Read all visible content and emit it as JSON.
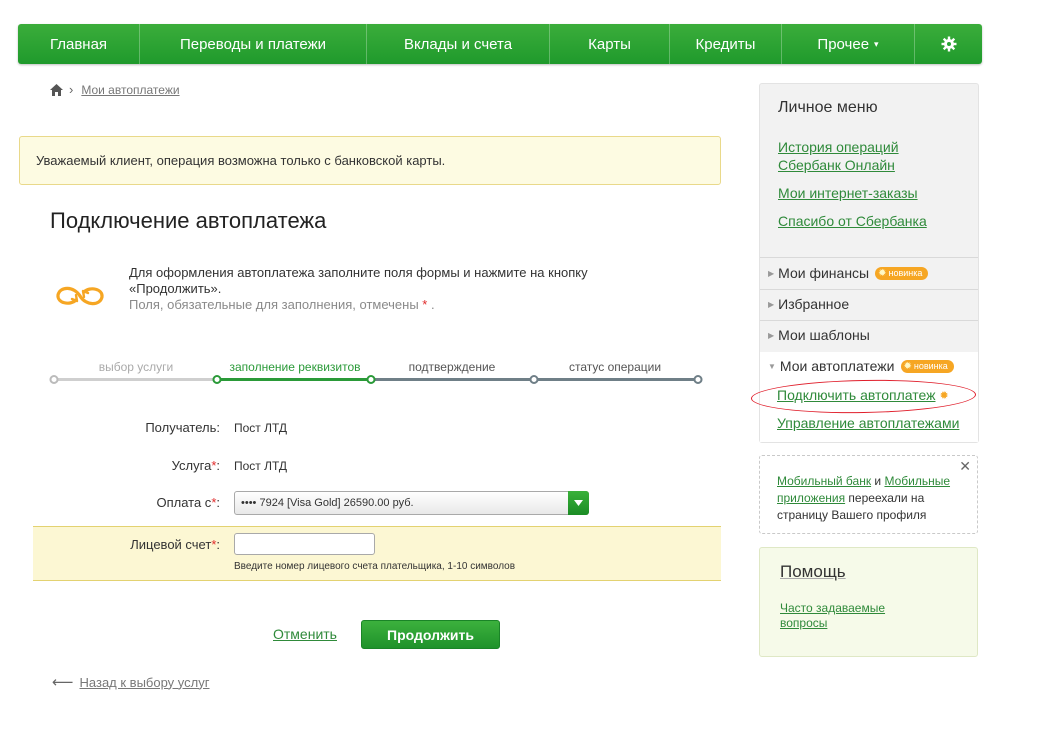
{
  "nav": {
    "items": [
      "Главная",
      "Переводы и платежи",
      "Вклады и счета",
      "Карты",
      "Кредиты",
      "Прочее"
    ],
    "settings_icon": "gear-icon"
  },
  "breadcrumb": {
    "home_icon": "home-icon",
    "link": "Мои автоплатежи"
  },
  "alert": {
    "text": "Уважаемый клиент, операция возможна только с банковской карты."
  },
  "page": {
    "title": "Подключение автоплатежа",
    "intro_icon": "infinity-icon",
    "intro_text": "Для оформления автоплатежа заполните поля формы и нажмите на кнопку «Продолжить».",
    "required_note_prefix": "Поля, обязательные для заполнения, отмечены",
    "required_star": "*",
    "required_note_suffix": "."
  },
  "steps": {
    "labels": [
      "выбор услуги",
      "заполнение реквизитов",
      "подтверждение",
      "статус операции"
    ],
    "active_index": 1
  },
  "form": {
    "recipient_label": "Получатель:",
    "recipient_value": "Пост ЛТД",
    "service_label": "Услуга",
    "service_value": "Пост ЛТД",
    "payment_label": "Оплата с",
    "payment_value": "•••• 7924 [Visa Gold] 26590.00 руб.",
    "account_label": "Лицевой счет",
    "account_value": "",
    "account_hint": "Введите номер лицевого счета плательщика, 1-10 символов",
    "star": "*",
    "colon": ":"
  },
  "actions": {
    "cancel": "Отменить",
    "continue": "Продолжить",
    "back": "Назад к выбору услуг"
  },
  "sidebar": {
    "title": "Личное меню",
    "links": [
      "История операций Сбербанк Онлайн",
      "Мои интернет-заказы",
      "Спасибо от Сбербанка"
    ],
    "sections": [
      "Мои финансы",
      "Избранное",
      "Мои шаблоны",
      "Мои автоплатежи"
    ],
    "badge": "новинка",
    "sub_links": [
      "Подключить автоплатеж",
      "Управление автоплатежами"
    ]
  },
  "notice": {
    "link1": "Мобильный банк",
    "and": " и ",
    "link2": "Мобильные приложения",
    "text": " переехали на страницу Вашего профиля"
  },
  "help": {
    "title": "Помощь",
    "link": "Часто задаваемые вопросы"
  },
  "colors": {
    "brand_green": "#21a038",
    "link_green": "#2f8a3a",
    "badge_orange": "#f6a623",
    "highlight_red": "#e01e2b"
  }
}
